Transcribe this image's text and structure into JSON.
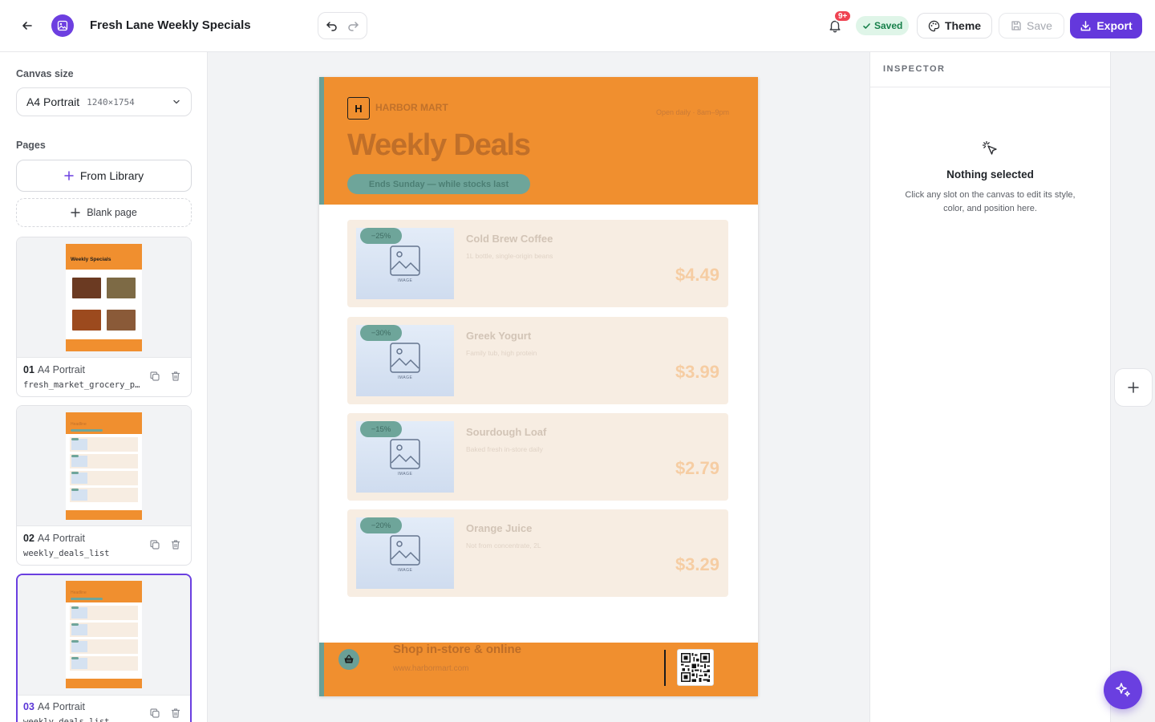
{
  "header": {
    "doc_title": "Fresh Lane Weekly Specials",
    "notification_count": "9+",
    "saved_label": "Saved",
    "theme_label": "Theme",
    "save_label": "Save",
    "export_label": "Export",
    "colors": {
      "brand": "#6438dc",
      "saved_bg": "#dff5e8",
      "badge": "#ef4352"
    }
  },
  "sidebar": {
    "canvas_size_label": "Canvas size",
    "canvas_size": {
      "name": "A4 Portrait",
      "dims": "1240×1754"
    },
    "pages_label": "Pages",
    "from_library_label": "From Library",
    "blank_page_label": "Blank page",
    "pages": [
      {
        "num": "01",
        "format": "A4 Portrait",
        "slug": "fresh_market_grocery_pr…",
        "selected": false
      },
      {
        "num": "02",
        "format": "A4 Portrait",
        "slug": "weekly_deals_list",
        "selected": false
      },
      {
        "num": "03",
        "format": "A4 Portrait",
        "slug": "weekly_deals_list",
        "selected": true
      }
    ],
    "thumb1_title": "Weekly Specials",
    "thumb_headline": "Headline"
  },
  "poster": {
    "brand_initial": "H",
    "brand_name": "HARBOR MART",
    "hours": "Open daily · 8am–9pm",
    "headline": "Weekly Deals",
    "ends_note": "Ends Sunday — while stocks last",
    "image_placeholder": "IMAGE",
    "deals": [
      {
        "discount": "−25%",
        "name": "Cold Brew Coffee",
        "desc": "1L bottle, single-origin beans",
        "price": "$4.49"
      },
      {
        "discount": "−30%",
        "name": "Greek Yogurt",
        "desc": "Family tub, high protein",
        "price": "$3.99"
      },
      {
        "discount": "−15%",
        "name": "Sourdough Loaf",
        "desc": "Baked fresh in-store daily",
        "price": "$2.79"
      },
      {
        "discount": "−20%",
        "name": "Orange Juice",
        "desc": "Not from concentrate, 2L",
        "price": "$3.29"
      }
    ],
    "footer_title": "Shop in-store & online",
    "footer_url": "www.harbormart.com",
    "colors": {
      "primary": "#f08f2f",
      "accent": "#6a9f96",
      "card": "#f7ede2"
    }
  },
  "inspector": {
    "title": "INSPECTOR",
    "empty_title": "Nothing selected",
    "empty_desc": "Click any slot on the canvas to edit its style, color, and position here."
  }
}
